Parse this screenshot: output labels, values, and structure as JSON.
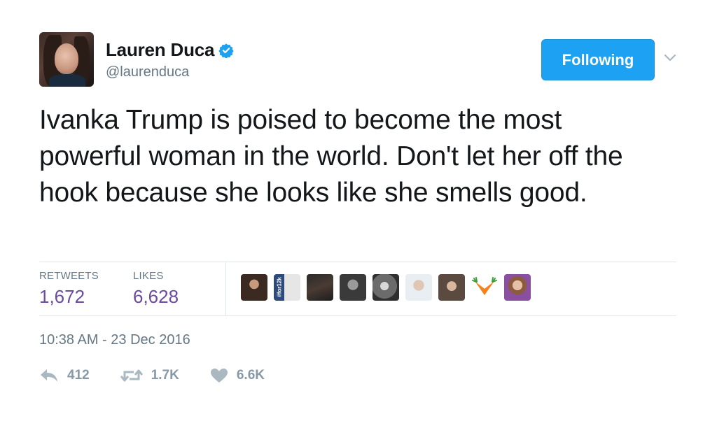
{
  "user": {
    "display_name": "Lauren Duca",
    "handle": "@laurenduca",
    "verified_icon": "verified-badge-icon"
  },
  "follow_button": {
    "label": "Following"
  },
  "tweet": {
    "text": "Ivanka Trump is poised to become the most powerful woman in the world. Don't let her off the hook because she looks like she smells good."
  },
  "stats": {
    "retweets_label": "RETWEETS",
    "retweets_count": "1,672",
    "likes_label": "LIKES",
    "likes_count": "6,628"
  },
  "likers": [
    {
      "avatar": "liker-avatar-1"
    },
    {
      "avatar": "liker-avatar-2",
      "text": "#for12k"
    },
    {
      "avatar": "liker-avatar-3"
    },
    {
      "avatar": "liker-avatar-4"
    },
    {
      "avatar": "liker-avatar-5"
    },
    {
      "avatar": "liker-avatar-6"
    },
    {
      "avatar": "liker-avatar-7"
    },
    {
      "avatar": "carrots-icon"
    },
    {
      "avatar": "liker-avatar-9"
    }
  ],
  "timestamp": "10:38 AM - 23 Dec 2016",
  "actions": {
    "reply_count": "412",
    "retweet_count": "1.7K",
    "like_count": "6.6K"
  },
  "colors": {
    "accent": "#1da1f2",
    "count_purple": "#6b4aa0",
    "muted": "#657786",
    "action_gray": "#8899a6"
  }
}
